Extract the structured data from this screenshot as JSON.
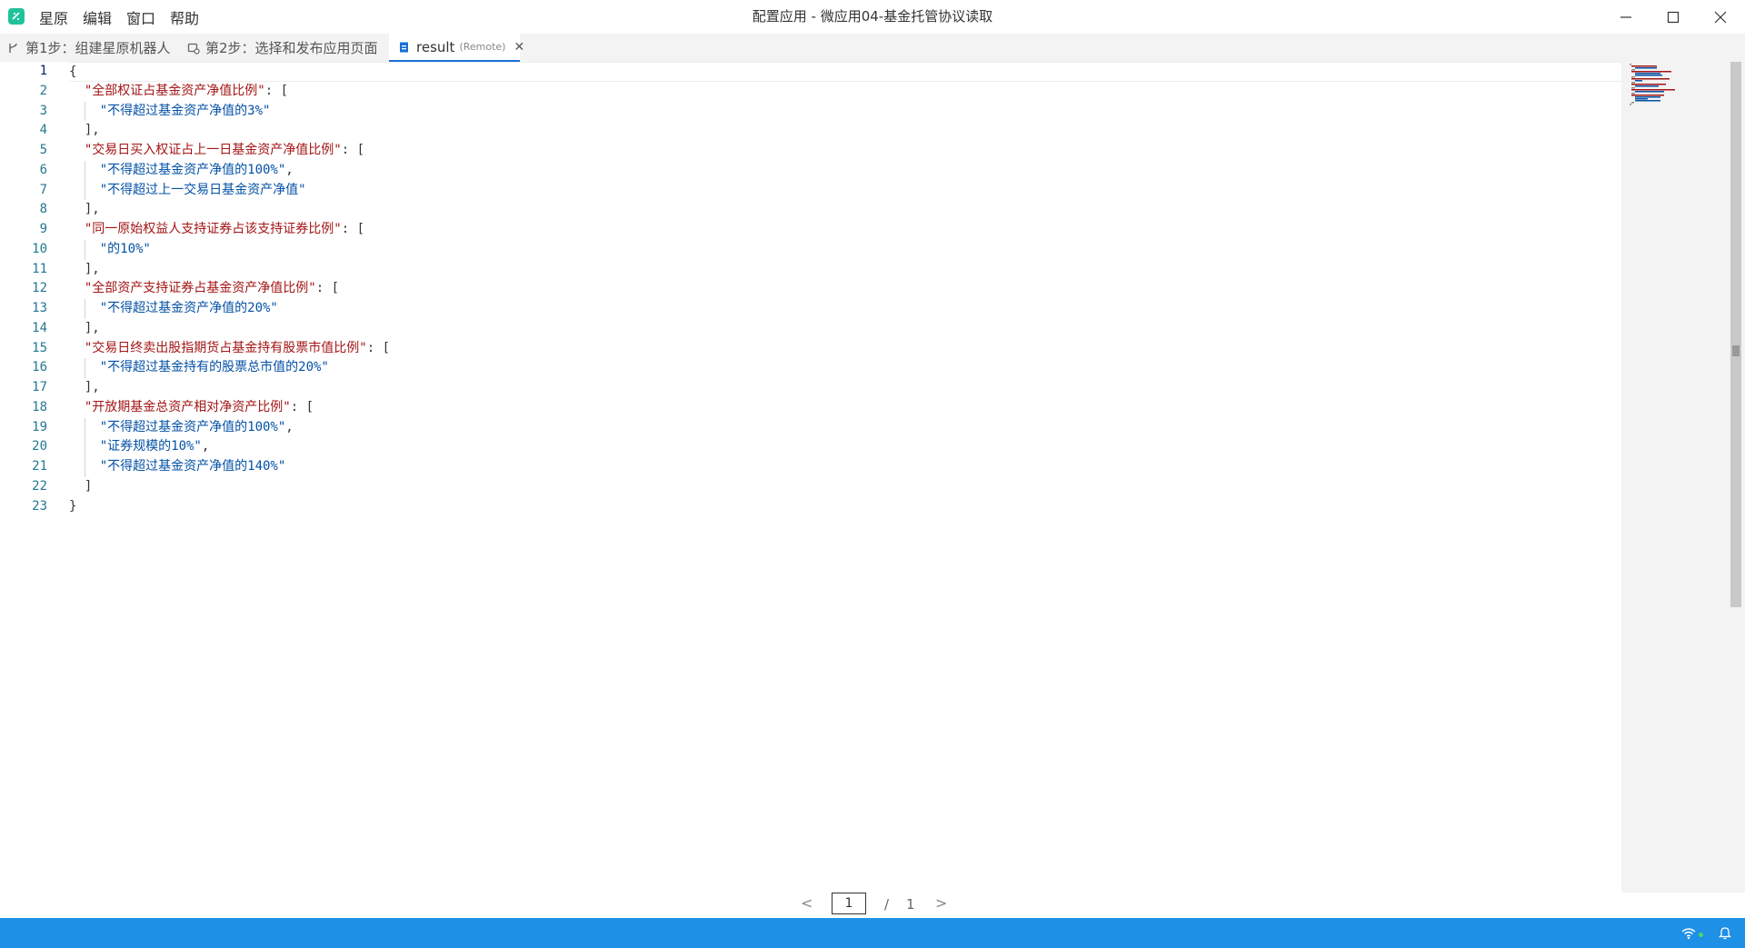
{
  "titlebar": {
    "menu": [
      "星原",
      "编辑",
      "窗口",
      "帮助"
    ],
    "title": "配置应用 - 微应用04-基金托管协议读取",
    "controls": [
      "minimize-icon",
      "maximize-icon",
      "close-icon"
    ]
  },
  "tabs": [
    {
      "label": "第1步：组建星原机器人",
      "icon": "branch-icon"
    },
    {
      "label": "第2步：选择和发布应用页面",
      "icon": "publish-icon"
    },
    {
      "label": "result",
      "tag": "(Remote)",
      "icon": "file-icon",
      "close": "✕"
    }
  ],
  "editor": {
    "lines": [
      {
        "n": "1",
        "parts": [
          [
            "p",
            "{"
          ]
        ]
      },
      {
        "n": "2",
        "parts": [
          [
            "p",
            "  "
          ],
          [
            "k",
            "\"全部权证占基金资产净值比例\""
          ],
          [
            "p",
            ": ["
          ]
        ]
      },
      {
        "n": "3",
        "parts": [
          [
            "p",
            "    "
          ],
          [
            "s",
            "\"不得超过基金资产净值的3%\""
          ]
        ]
      },
      {
        "n": "4",
        "parts": [
          [
            "p",
            "  ],"
          ]
        ]
      },
      {
        "n": "5",
        "parts": [
          [
            "p",
            "  "
          ],
          [
            "k",
            "\"交易日买入权证占上一日基金资产净值比例\""
          ],
          [
            "p",
            ": ["
          ]
        ]
      },
      {
        "n": "6",
        "parts": [
          [
            "p",
            "    "
          ],
          [
            "s",
            "\"不得超过基金资产净值的100%\""
          ],
          [
            "p",
            ","
          ]
        ]
      },
      {
        "n": "7",
        "parts": [
          [
            "p",
            "    "
          ],
          [
            "s",
            "\"不得超过上一交易日基金资产净值\""
          ]
        ]
      },
      {
        "n": "8",
        "parts": [
          [
            "p",
            "  ],"
          ]
        ]
      },
      {
        "n": "9",
        "parts": [
          [
            "p",
            "  "
          ],
          [
            "k",
            "\"同一原始权益人支持证券占该支持证券比例\""
          ],
          [
            "p",
            ": ["
          ]
        ]
      },
      {
        "n": "10",
        "parts": [
          [
            "p",
            "    "
          ],
          [
            "s",
            "\"的10%\""
          ]
        ]
      },
      {
        "n": "11",
        "parts": [
          [
            "p",
            "  ],"
          ]
        ]
      },
      {
        "n": "12",
        "parts": [
          [
            "p",
            "  "
          ],
          [
            "k",
            "\"全部资产支持证券占基金资产净值比例\""
          ],
          [
            "p",
            ": ["
          ]
        ]
      },
      {
        "n": "13",
        "parts": [
          [
            "p",
            "    "
          ],
          [
            "s",
            "\"不得超过基金资产净值的20%\""
          ]
        ]
      },
      {
        "n": "14",
        "parts": [
          [
            "p",
            "  ],"
          ]
        ]
      },
      {
        "n": "15",
        "parts": [
          [
            "p",
            "  "
          ],
          [
            "k",
            "\"交易日终卖出股指期货占基金持有股票市值比例\""
          ],
          [
            "p",
            ": ["
          ]
        ]
      },
      {
        "n": "16",
        "parts": [
          [
            "p",
            "    "
          ],
          [
            "s",
            "\"不得超过基金持有的股票总市值的20%\""
          ]
        ]
      },
      {
        "n": "17",
        "parts": [
          [
            "p",
            "  ],"
          ]
        ]
      },
      {
        "n": "18",
        "parts": [
          [
            "p",
            "  "
          ],
          [
            "k",
            "\"开放期基金总资产相对净资产比例\""
          ],
          [
            "p",
            ": ["
          ]
        ]
      },
      {
        "n": "19",
        "parts": [
          [
            "p",
            "    "
          ],
          [
            "s",
            "\"不得超过基金资产净值的100%\""
          ],
          [
            "p",
            ","
          ]
        ]
      },
      {
        "n": "20",
        "parts": [
          [
            "p",
            "    "
          ],
          [
            "s",
            "\"证券规模的10%\""
          ],
          [
            "p",
            ","
          ]
        ]
      },
      {
        "n": "21",
        "parts": [
          [
            "p",
            "    "
          ],
          [
            "s",
            "\"不得超过基金资产净值的140%\""
          ]
        ]
      },
      {
        "n": "22",
        "parts": [
          [
            "p",
            "  ]"
          ]
        ]
      },
      {
        "n": "23",
        "parts": [
          [
            "p",
            "}"
          ]
        ]
      }
    ],
    "active_line": "1"
  },
  "pager": {
    "prev": "<",
    "current": "1",
    "separator": "/",
    "total": "1",
    "next": ">"
  },
  "statusbar": {
    "icons": [
      "wifi-icon",
      "bell-icon"
    ]
  },
  "colors": {
    "accent": "#1e90e6",
    "key": "#a31515",
    "string": "#0451a5",
    "line_number": "#237893"
  }
}
